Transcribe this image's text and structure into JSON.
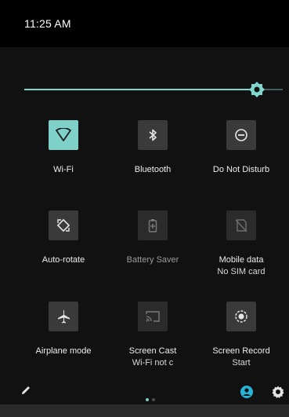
{
  "status": {
    "time": "11:25 AM"
  },
  "brightness": {
    "level": 0.9
  },
  "tiles": [
    {
      "label": "Wi-Fi",
      "sub": "",
      "icon": "wifi-icon",
      "state": "active"
    },
    {
      "label": "Bluetooth",
      "sub": "",
      "icon": "bluetooth-icon",
      "state": "off"
    },
    {
      "label": "Do Not Disturb",
      "sub": "",
      "icon": "do-not-disturb-icon",
      "state": "off"
    },
    {
      "label": "Auto-rotate",
      "sub": "",
      "icon": "auto-rotate-icon",
      "state": "off"
    },
    {
      "label": "Battery Saver",
      "sub": "",
      "icon": "battery-saver-icon",
      "state": "disabled"
    },
    {
      "label": "Mobile data",
      "sub": "No SIM card",
      "icon": "mobile-data-icon",
      "state": "disabled"
    },
    {
      "label": "Airplane mode",
      "sub": "",
      "icon": "airplane-icon",
      "state": "off"
    },
    {
      "label": "Screen Cast",
      "sub": "Wi-Fi not c",
      "icon": "screen-cast-icon",
      "state": "disabled"
    },
    {
      "label": "Screen Record",
      "sub": "Start",
      "icon": "screen-record-icon",
      "state": "off"
    }
  ],
  "footer": {
    "page_count": 2,
    "current_page": 0
  },
  "colors": {
    "accent": "#7fd0c9",
    "background": "#111111"
  }
}
